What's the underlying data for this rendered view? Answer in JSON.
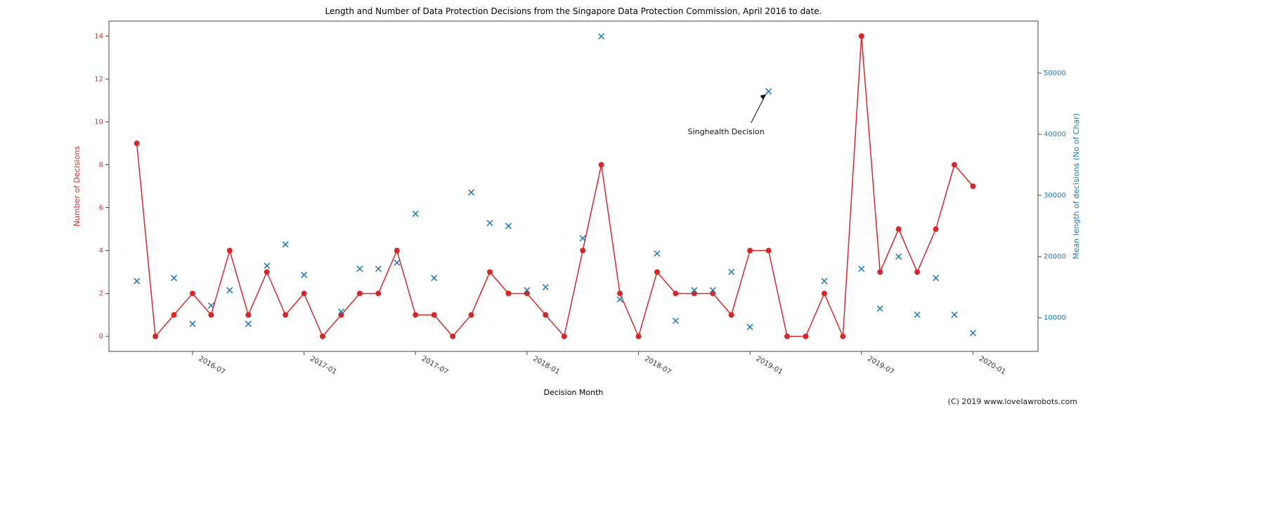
{
  "chart_data": {
    "type": "line",
    "title": "Length and Number of Data Protection Decisions from the Singapore Data Protection Commission, April 2016 to date.",
    "xlabel": "Decision Month",
    "ylabel_left": "Number of Decisions",
    "ylabel_right": "Mean length of decisions (No of Char)",
    "x_ticks": [
      "2016-07",
      "2017-01",
      "2017-07",
      "2018-01",
      "2018-07",
      "2019-01",
      "2019-07",
      "2020-01"
    ],
    "y_left_ticks": [
      0,
      2,
      4,
      6,
      8,
      10,
      12,
      14
    ],
    "y_right_ticks": [
      10000,
      20000,
      30000,
      40000,
      50000
    ],
    "y_left_range": [
      -0.7,
      14.7
    ],
    "y_right_range": [
      4500,
      58500
    ],
    "x_range_months": [
      -1.5,
      48.5
    ],
    "months_start": "2016-04",
    "copyright": "(C) 2019 www.lovelawrobots.com",
    "annotation": {
      "text": "Singhealth Decision",
      "target_month_index": 34,
      "target_value_right": 47000
    },
    "series": [
      {
        "name": "Number of Decisions",
        "y_axis": "left",
        "style": "line+dots",
        "color": "#d62728",
        "values": [
          9,
          0,
          1,
          2,
          1,
          4,
          1,
          3,
          1,
          2,
          0,
          1,
          2,
          2,
          4,
          1,
          1,
          0,
          1,
          3,
          2,
          2,
          1,
          0,
          4,
          8,
          2,
          0,
          3,
          2,
          2,
          2,
          1,
          4,
          4,
          0,
          0,
          2,
          0,
          14,
          3,
          5,
          3,
          5,
          8,
          7
        ]
      },
      {
        "name": "Mean length of decisions (No of Char)",
        "y_axis": "right",
        "style": "x-markers",
        "color": "#1f77b4",
        "values": [
          16000,
          null,
          16500,
          9000,
          12000,
          14500,
          9000,
          18500,
          22000,
          17000,
          null,
          11000,
          18000,
          18000,
          19000,
          27000,
          16500,
          null,
          30500,
          25500,
          25000,
          14500,
          15000,
          null,
          23000,
          56000,
          13000,
          null,
          20500,
          9500,
          14500,
          14500,
          17500,
          8500,
          47000,
          null,
          null,
          16000,
          null,
          18000,
          11500,
          20000,
          10500,
          16500,
          10500,
          7500
        ]
      }
    ]
  }
}
